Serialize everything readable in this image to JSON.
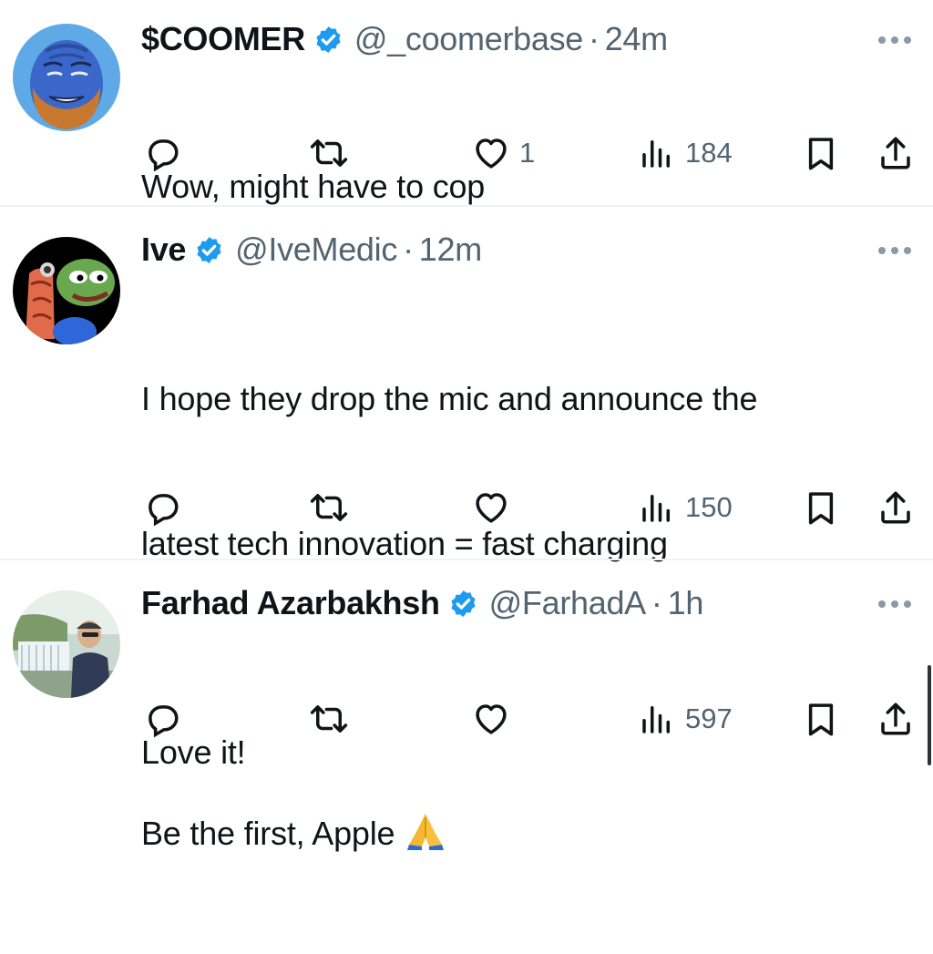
{
  "colors": {
    "verified": "#1d9bf0",
    "muted": "#536471",
    "text": "#0f1419",
    "divider": "#eff3f4"
  },
  "tweets": [
    {
      "name": "$COOMER",
      "handle": "@_coomerbase",
      "dot": "·",
      "time": "24m",
      "lines": [
        "Wow, might have to cop"
      ],
      "likes": "1",
      "views": "184",
      "avatar": "blue-face-avatar"
    },
    {
      "name": "Ive",
      "handle": "@IveMedic",
      "dot": "·",
      "time": "12m",
      "lines": [
        "I hope they drop the mic and announce the",
        "latest tech innovation = fast charging",
        "",
        "Be the first, Apple"
      ],
      "emoji": "folded-hands-emoji",
      "likes": "",
      "views": "150",
      "avatar": "frog-avatar"
    },
    {
      "name": "Farhad Azarbakhsh",
      "handle": "@FarhadA",
      "dot": "·",
      "time": "1h",
      "lines": [
        "Love it!"
      ],
      "likes": "",
      "views": "597",
      "avatar": "waterfall-photo-avatar"
    }
  ]
}
